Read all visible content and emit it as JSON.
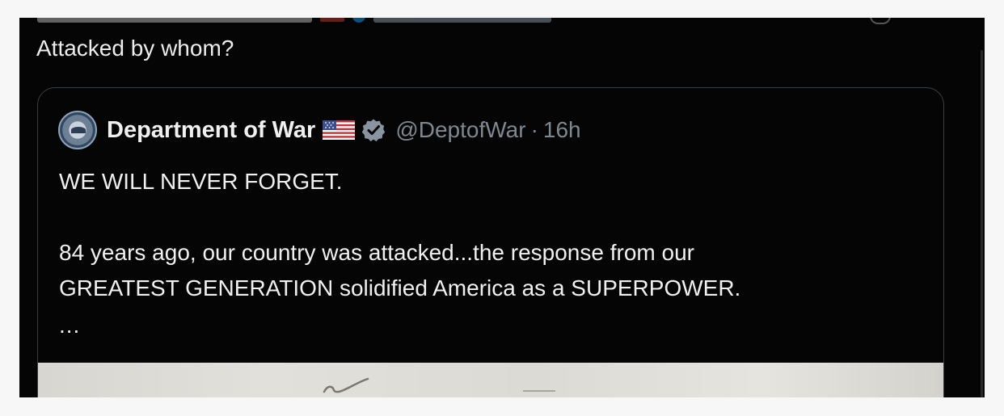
{
  "reply": {
    "text": "Attacked by whom?"
  },
  "quoted_post": {
    "display_name": "Department of War",
    "handle": "@DeptofWar",
    "separator": "·",
    "time": "16h",
    "lines": [
      "WE WILL NEVER FORGET.",
      "84 years ago, our country was attacked...the response from our",
      "GREATEST GENERATION solidified America as a SUPERPOWER.",
      "..."
    ]
  },
  "icons": {
    "avatar": "department-seal-icon",
    "flag": "us-flag-icon",
    "verified": "verified-badge-icon"
  },
  "colors": {
    "background": "#050505",
    "text": "#f0f0f0",
    "secondary_text": "#7f8890",
    "card_border": "#3a3f44",
    "verified": "#8a94a0"
  }
}
